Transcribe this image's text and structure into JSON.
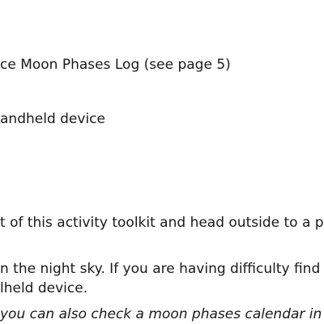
{
  "document": {
    "lines": [
      "ce Moon Phases Log (see page 5)",
      "andheld device",
      "t of this activity toolkit and head outside to a p",
      "n the night sky. If you are having difficulty find",
      "lheld device.",
      " you can also check a moon phases calendar in"
    ]
  }
}
